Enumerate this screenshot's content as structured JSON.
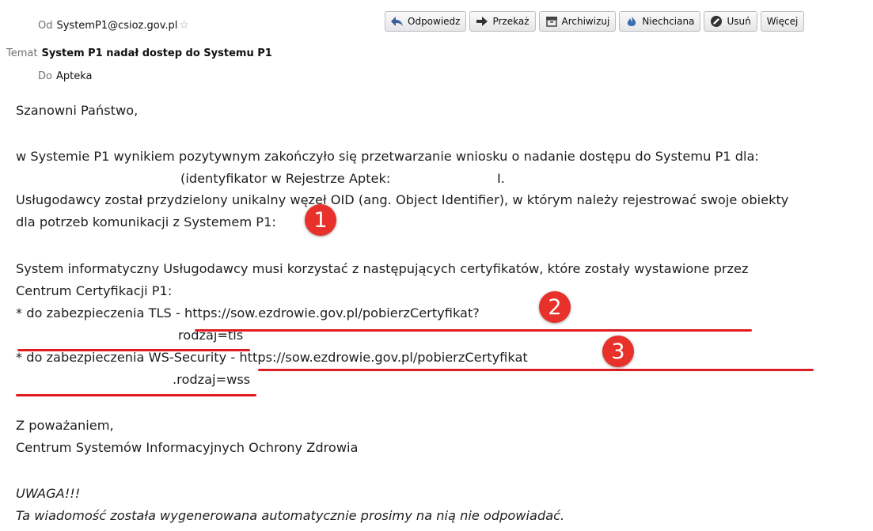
{
  "header": {
    "from_label": "Od",
    "from_value": "SystemP1@csioz.gov.pl",
    "subject_label": "Temat",
    "subject_value": "System P1 nadał dostep do Systemu P1",
    "to_label": "Do",
    "to_value": "Apteka"
  },
  "toolbar": {
    "reply": "Odpowiedz",
    "forward": "Przekaż",
    "archive": "Archiwizuj",
    "junk": "Niechciana",
    "delete": "Usuń",
    "more": "Więcej"
  },
  "message": {
    "greeting": "Szanowni Państwo,",
    "p1_line1": "w Systemie P1 wynikiem pozytywnym zakończyło się przetwarzanie wniosku o nadanie dostępu do Systemu P1 dla:",
    "p1_line2": "(identyfikator w Rejestrze Aptek:",
    "p1_line2_end": "I.",
    "p1_line3": "Usługodawcy został przydzielony unikalny węzeł OID (ang. Object Identifier), w którym należy rejestrować swoje obiekty",
    "p1_line4": "dla potrzeb komunikacji z Systemem P1:",
    "p2_line1": "System informatyczny Usługodawcy musi korzystać z następujących certyfikatów, które zostały wystawione przez",
    "p2_line2": "Centrum Certyfikacji P1:",
    "tls_prefix": "* do zabezpieczenia TLS - ",
    "tls_url": "https://sow.ezdrowie.gov.pl/pobierzCertyfikat?",
    "tls_param": "rodzaj=tls",
    "wss_prefix": "* do zabezpieczenia WS-Security - ",
    "wss_url": "https://sow.ezdrowie.gov.pl/pobierzCertyfikat",
    "wss_param": ".rodzaj=wss",
    "closing": "Z poważaniem,",
    "signature": "Centrum Systemów Informacyjnych Ochrony Zdrowia",
    "warning_title": "UWAGA!!!",
    "warning_text": "Ta wiadomość została wygenerowana automatycznie prosimy na nią nie odpowiadać."
  },
  "badges": [
    "1",
    "2",
    "3"
  ],
  "colors": {
    "annotation_red": "#e11b22",
    "badge_red": "#e8312a"
  }
}
